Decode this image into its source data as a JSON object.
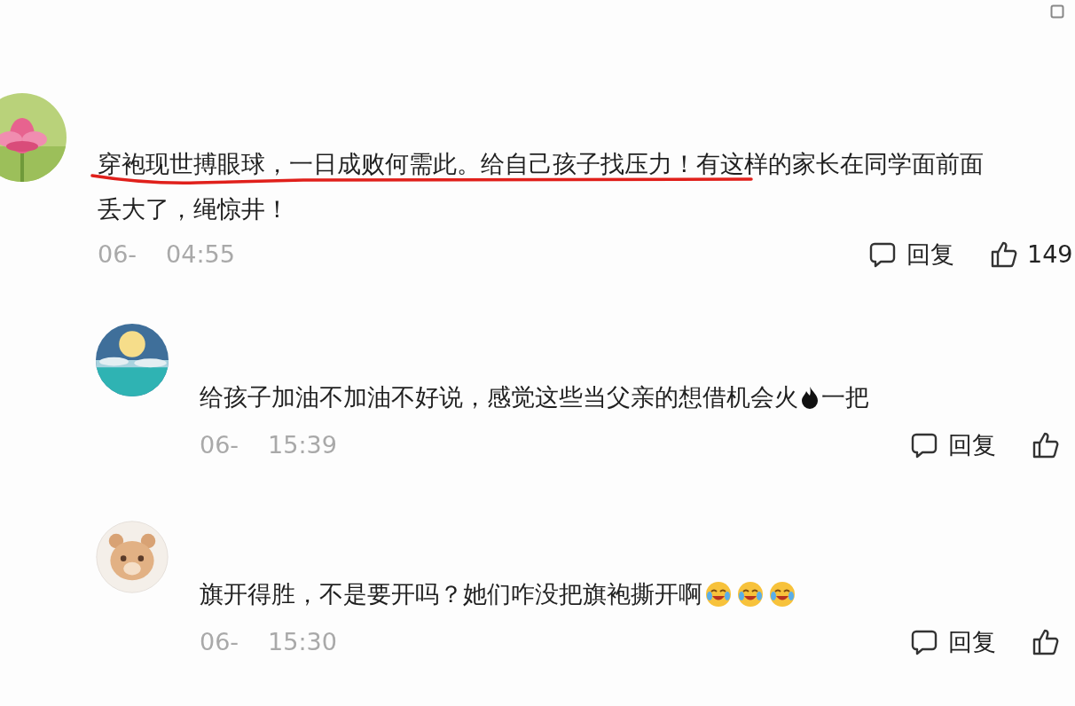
{
  "comments": [
    {
      "underlined": true,
      "lines": [
        [
          {
            "kind": "text",
            "text": "穿袍现世搏眼球，一日成败何需此。给自己孩子找压力！有这样的家长在同学面前面"
          }
        ],
        [
          {
            "kind": "text",
            "text": "丢大了，绳惊井！"
          }
        ]
      ],
      "date": "06-",
      "time": "04:55",
      "reply_label": "回复",
      "likes": "149",
      "replies": [
        {
          "lines": [
            [
              {
                "kind": "text",
                "text": "给孩子加油不加油不好说，感觉这些当父亲的想借机会火"
              },
              {
                "kind": "fire"
              },
              {
                "kind": "text",
                "text": "一把"
              }
            ]
          ],
          "date": "06-",
          "time": "15:39",
          "reply_label": "回复"
        },
        {
          "lines": [
            [
              {
                "kind": "text",
                "text": "旗开得胜，不是要开吗？她们咋没把旗袍撕开啊"
              },
              {
                "kind": "laugh-cry"
              },
              {
                "kind": "laugh-cry"
              },
              {
                "kind": "laugh-cry"
              }
            ]
          ],
          "date": "06-",
          "time": "15:30",
          "reply_label": "回复"
        }
      ]
    }
  ]
}
